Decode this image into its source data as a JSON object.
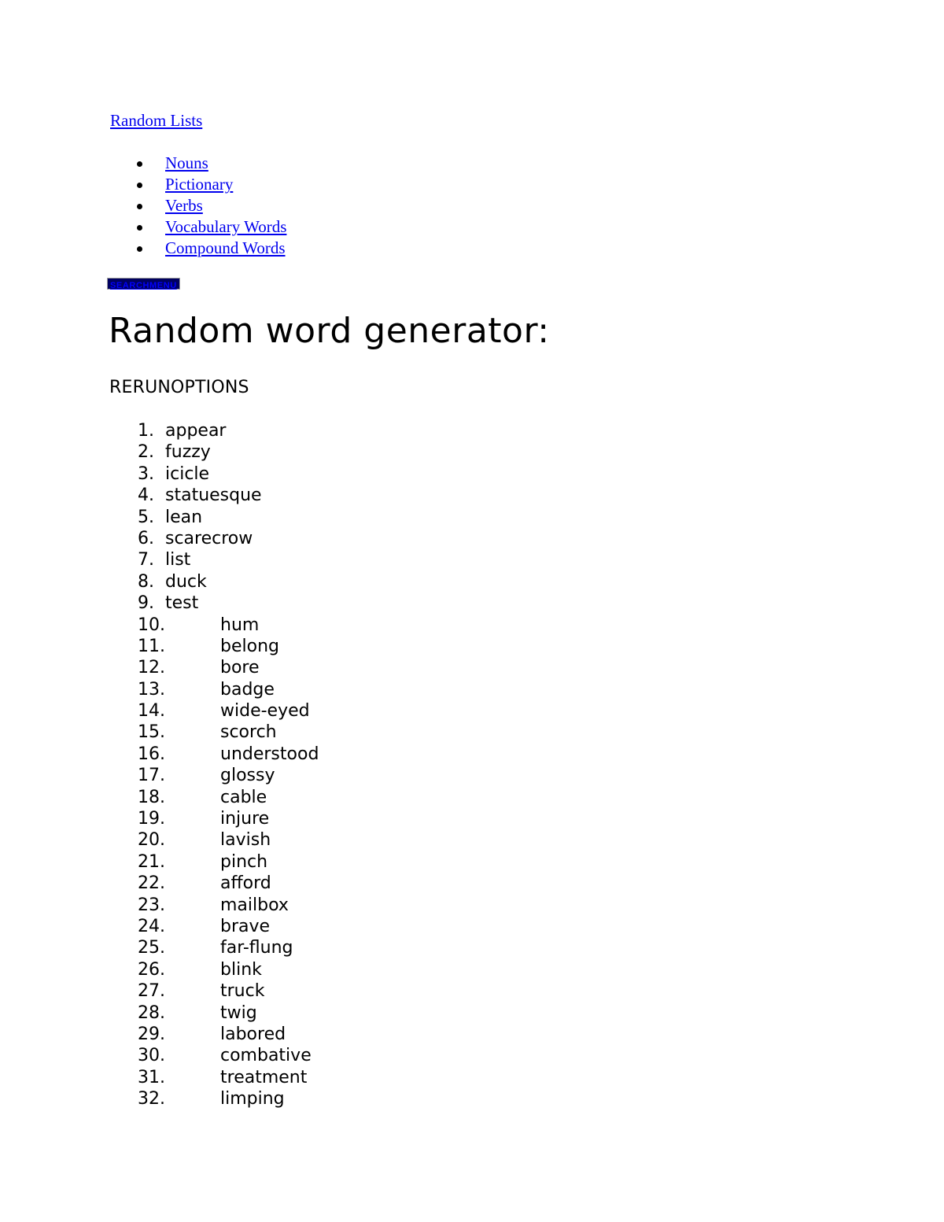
{
  "nav": {
    "heading": "Random Lists",
    "items": [
      {
        "label": "Nouns"
      },
      {
        "label": "Pictionary"
      },
      {
        "label": "Verbs"
      },
      {
        "label": "Vocabulary Words"
      },
      {
        "label": "Compound Words"
      }
    ]
  },
  "searchmenu": {
    "label": "SEARCHMENU",
    "text_color": "#0000ff",
    "background_color": "#000060"
  },
  "main": {
    "title": "Random word generator:",
    "controls_label": "RERUNOPTIONS"
  },
  "colors": {
    "link": "#0000ee",
    "text": "#000000",
    "page_background": "#ffffff"
  },
  "word_list": {
    "count": 32,
    "items": [
      {
        "number": "1.",
        "word": "appear"
      },
      {
        "number": "2.",
        "word": "fuzzy"
      },
      {
        "number": "3.",
        "word": "icicle"
      },
      {
        "number": "4.",
        "word": "statuesque"
      },
      {
        "number": "5.",
        "word": "lean"
      },
      {
        "number": "6.",
        "word": "scarecrow"
      },
      {
        "number": "7.",
        "word": "list"
      },
      {
        "number": "8.",
        "word": "duck"
      },
      {
        "number": "9.",
        "word": "test"
      },
      {
        "number": "10.",
        "word": "hum"
      },
      {
        "number": "11.",
        "word": "belong"
      },
      {
        "number": "12.",
        "word": "bore"
      },
      {
        "number": "13.",
        "word": "badge"
      },
      {
        "number": "14.",
        "word": "wide-eyed"
      },
      {
        "number": "15.",
        "word": "scorch"
      },
      {
        "number": "16.",
        "word": "understood"
      },
      {
        "number": "17.",
        "word": "glossy"
      },
      {
        "number": "18.",
        "word": "cable"
      },
      {
        "number": "19.",
        "word": "injure"
      },
      {
        "number": "20.",
        "word": "lavish"
      },
      {
        "number": "21.",
        "word": "pinch"
      },
      {
        "number": "22.",
        "word": "afford"
      },
      {
        "number": "23.",
        "word": "mailbox"
      },
      {
        "number": "24.",
        "word": "brave"
      },
      {
        "number": "25.",
        "word": "far-flung"
      },
      {
        "number": "26.",
        "word": "blink"
      },
      {
        "number": "27.",
        "word": "truck"
      },
      {
        "number": "28.",
        "word": "twig"
      },
      {
        "number": "29.",
        "word": "labored"
      },
      {
        "number": "30.",
        "word": "combative"
      },
      {
        "number": "31.",
        "word": "treatment"
      },
      {
        "number": "32.",
        "word": "limping"
      }
    ]
  }
}
